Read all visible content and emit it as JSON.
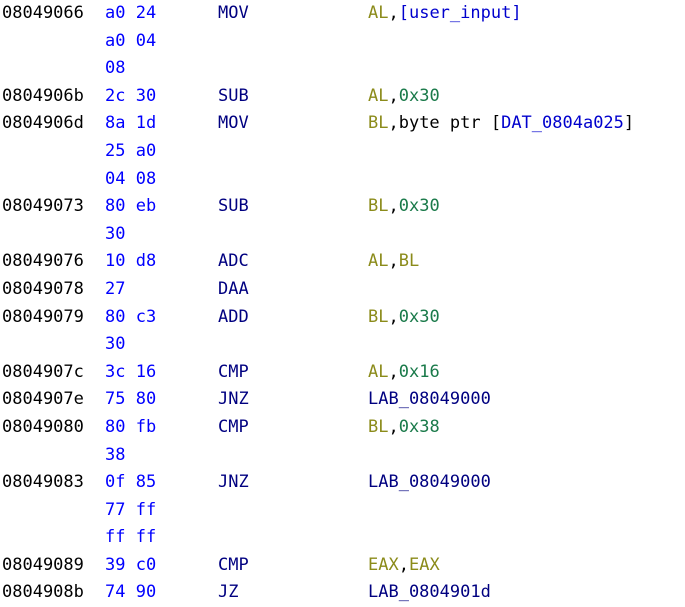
{
  "view": {
    "kind": "disassembly-listing",
    "background_color": "#ffffff",
    "colors": {
      "address": "#000000",
      "bytes": "#0000ff",
      "mnemonic": "#000080",
      "register": "#8b8b1a",
      "constant": "#1a7a4a",
      "symbol": "#0000cd",
      "label": "#000080",
      "punctuation": "#000000"
    }
  },
  "lines": [
    {
      "address": "08049066",
      "bytes": "a0 24",
      "mnemonic": "MOV",
      "operand_tokens": [
        {
          "text": "AL",
          "kind": "register"
        },
        {
          "text": ",",
          "kind": "plain"
        },
        {
          "text": "[user_input]",
          "kind": "symbol"
        }
      ]
    },
    {
      "address": "",
      "bytes": "a0 04",
      "mnemonic": "",
      "operand_tokens": []
    },
    {
      "address": "",
      "bytes": "08",
      "mnemonic": "",
      "operand_tokens": []
    },
    {
      "address": "0804906b",
      "bytes": "2c 30",
      "mnemonic": "SUB",
      "operand_tokens": [
        {
          "text": "AL",
          "kind": "register"
        },
        {
          "text": ",",
          "kind": "plain"
        },
        {
          "text": "0x30",
          "kind": "constant"
        }
      ]
    },
    {
      "address": "0804906d",
      "bytes": "8a 1d",
      "mnemonic": "MOV",
      "operand_tokens": [
        {
          "text": "BL",
          "kind": "register"
        },
        {
          "text": ",byte ptr [",
          "kind": "plain"
        },
        {
          "text": "DAT_0804a025",
          "kind": "symbol"
        },
        {
          "text": "]",
          "kind": "plain"
        }
      ]
    },
    {
      "address": "",
      "bytes": "25 a0",
      "mnemonic": "",
      "operand_tokens": []
    },
    {
      "address": "",
      "bytes": "04 08",
      "mnemonic": "",
      "operand_tokens": []
    },
    {
      "address": "08049073",
      "bytes": "80 eb",
      "mnemonic": "SUB",
      "operand_tokens": [
        {
          "text": "BL",
          "kind": "register"
        },
        {
          "text": ",",
          "kind": "plain"
        },
        {
          "text": "0x30",
          "kind": "constant"
        }
      ]
    },
    {
      "address": "",
      "bytes": "30",
      "mnemonic": "",
      "operand_tokens": []
    },
    {
      "address": "08049076",
      "bytes": "10 d8",
      "mnemonic": "ADC",
      "operand_tokens": [
        {
          "text": "AL",
          "kind": "register"
        },
        {
          "text": ",",
          "kind": "plain"
        },
        {
          "text": "BL",
          "kind": "register"
        }
      ]
    },
    {
      "address": "08049078",
      "bytes": "27",
      "mnemonic": "DAA",
      "operand_tokens": []
    },
    {
      "address": "08049079",
      "bytes": "80 c3",
      "mnemonic": "ADD",
      "operand_tokens": [
        {
          "text": "BL",
          "kind": "register"
        },
        {
          "text": ",",
          "kind": "plain"
        },
        {
          "text": "0x30",
          "kind": "constant"
        }
      ]
    },
    {
      "address": "",
      "bytes": "30",
      "mnemonic": "",
      "operand_tokens": []
    },
    {
      "address": "0804907c",
      "bytes": "3c 16",
      "mnemonic": "CMP",
      "operand_tokens": [
        {
          "text": "AL",
          "kind": "register"
        },
        {
          "text": ",",
          "kind": "plain"
        },
        {
          "text": "0x16",
          "kind": "constant"
        }
      ]
    },
    {
      "address": "0804907e",
      "bytes": "75 80",
      "mnemonic": "JNZ",
      "operand_tokens": [
        {
          "text": "LAB_08049000",
          "kind": "label"
        }
      ]
    },
    {
      "address": "08049080",
      "bytes": "80 fb",
      "mnemonic": "CMP",
      "operand_tokens": [
        {
          "text": "BL",
          "kind": "register"
        },
        {
          "text": ",",
          "kind": "plain"
        },
        {
          "text": "0x38",
          "kind": "constant"
        }
      ]
    },
    {
      "address": "",
      "bytes": "38",
      "mnemonic": "",
      "operand_tokens": []
    },
    {
      "address": "08049083",
      "bytes": "0f 85",
      "mnemonic": "JNZ",
      "operand_tokens": [
        {
          "text": "LAB_08049000",
          "kind": "label"
        }
      ]
    },
    {
      "address": "",
      "bytes": "77 ff",
      "mnemonic": "",
      "operand_tokens": []
    },
    {
      "address": "",
      "bytes": "ff ff",
      "mnemonic": "",
      "operand_tokens": []
    },
    {
      "address": "08049089",
      "bytes": "39 c0",
      "mnemonic": "CMP",
      "operand_tokens": [
        {
          "text": "EAX",
          "kind": "register"
        },
        {
          "text": ",",
          "kind": "plain"
        },
        {
          "text": "EAX",
          "kind": "register"
        }
      ]
    },
    {
      "address": "0804908b",
      "bytes": "74 90",
      "mnemonic": "JZ",
      "operand_tokens": [
        {
          "text": "LAB_0804901d",
          "kind": "label"
        }
      ]
    }
  ]
}
